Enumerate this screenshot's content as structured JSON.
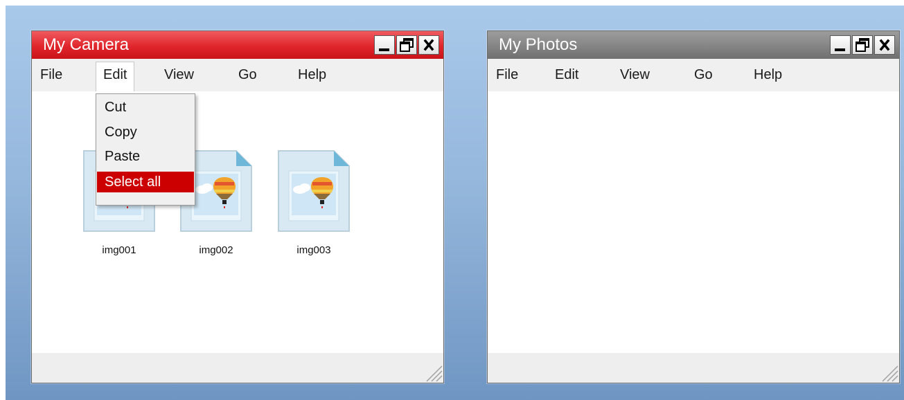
{
  "colors": {
    "accent": "#cc0000",
    "active_title": "#e0262c",
    "inactive_title": "#858585",
    "desktop": "#95b7dc"
  },
  "camera_window": {
    "title": "My Camera",
    "controls": [
      "minimize-icon",
      "restore-icon",
      "close-icon"
    ],
    "menu": [
      "File",
      "Edit",
      "View",
      "Go",
      "Help"
    ],
    "open_menu": "Edit",
    "dropdown": [
      "Cut",
      "Copy",
      "Paste",
      "Select all"
    ],
    "highlighted_item": "Select all",
    "files": [
      {
        "name": "img001",
        "icon": "image-file-icon"
      },
      {
        "name": "img002",
        "icon": "image-file-icon"
      },
      {
        "name": "img003",
        "icon": "image-file-icon"
      }
    ]
  },
  "photos_window": {
    "title": "My Photos",
    "controls": [
      "minimize-icon",
      "restore-icon",
      "close-icon"
    ],
    "menu": [
      "File",
      "Edit",
      "View",
      "Go",
      "Help"
    ]
  }
}
